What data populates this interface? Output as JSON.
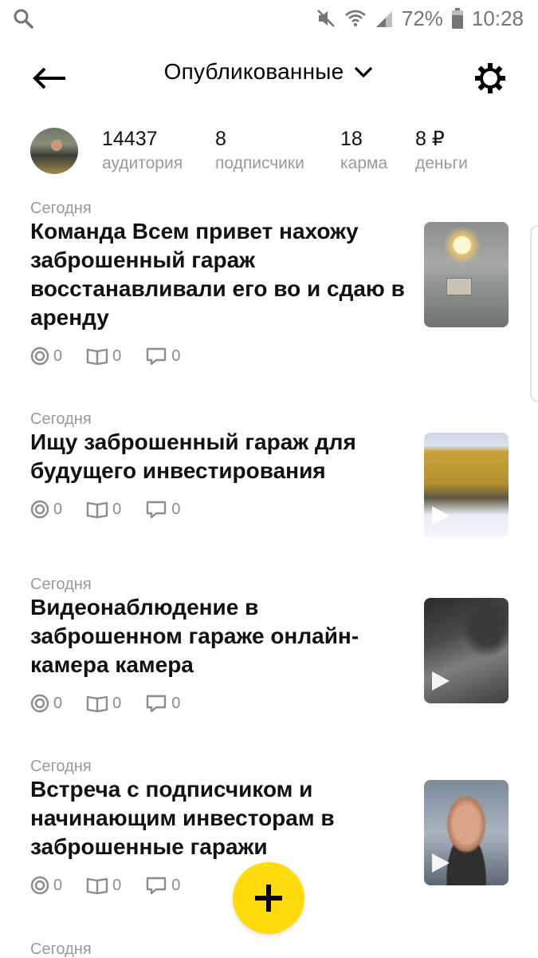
{
  "status_bar": {
    "battery_percent": "72%",
    "time": "10:28",
    "icons": [
      "search-icon",
      "mute-icon",
      "wifi-icon",
      "signal-icon",
      "battery-icon"
    ]
  },
  "header": {
    "title": "Опубликованные",
    "icons": [
      "back-arrow-icon",
      "chevron-down-icon",
      "gear-icon"
    ]
  },
  "profile": {
    "stats": [
      {
        "value": "14437",
        "label": "аудитория"
      },
      {
        "value": "8",
        "label": "подписчики"
      },
      {
        "value": "18",
        "label": "карма"
      },
      {
        "value": "8 ₽",
        "label": "деньги"
      }
    ]
  },
  "posts": [
    {
      "date": "Сегодня",
      "title": "Команда Всем привет нахожу заброшенный гараж восстанавливали его во и сдаю в аренду",
      "views": "0",
      "reads": "0",
      "comments": "0",
      "is_video": false
    },
    {
      "date": "Сегодня",
      "title": "Ищу заброшенный гараж для будущего инвестирования",
      "views": "0",
      "reads": "0",
      "comments": "0",
      "is_video": true
    },
    {
      "date": "Сегодня",
      "title": "Видеонаблюдение в заброшенном гараже онлайн-камера камера",
      "views": "0",
      "reads": "0",
      "comments": "0",
      "is_video": true
    },
    {
      "date": "Сегодня",
      "title": "Встреча с подписчиком и начинающим инвесторам в заброшенные гаражи",
      "views": "0",
      "reads": "0",
      "comments": "0",
      "is_video": true
    },
    {
      "date": "Сегодня"
    }
  ],
  "colors": {
    "accent_fab": "#ffdb0d",
    "muted_text": "#9a9a9a",
    "icon_gray": "#8c8c8c"
  }
}
